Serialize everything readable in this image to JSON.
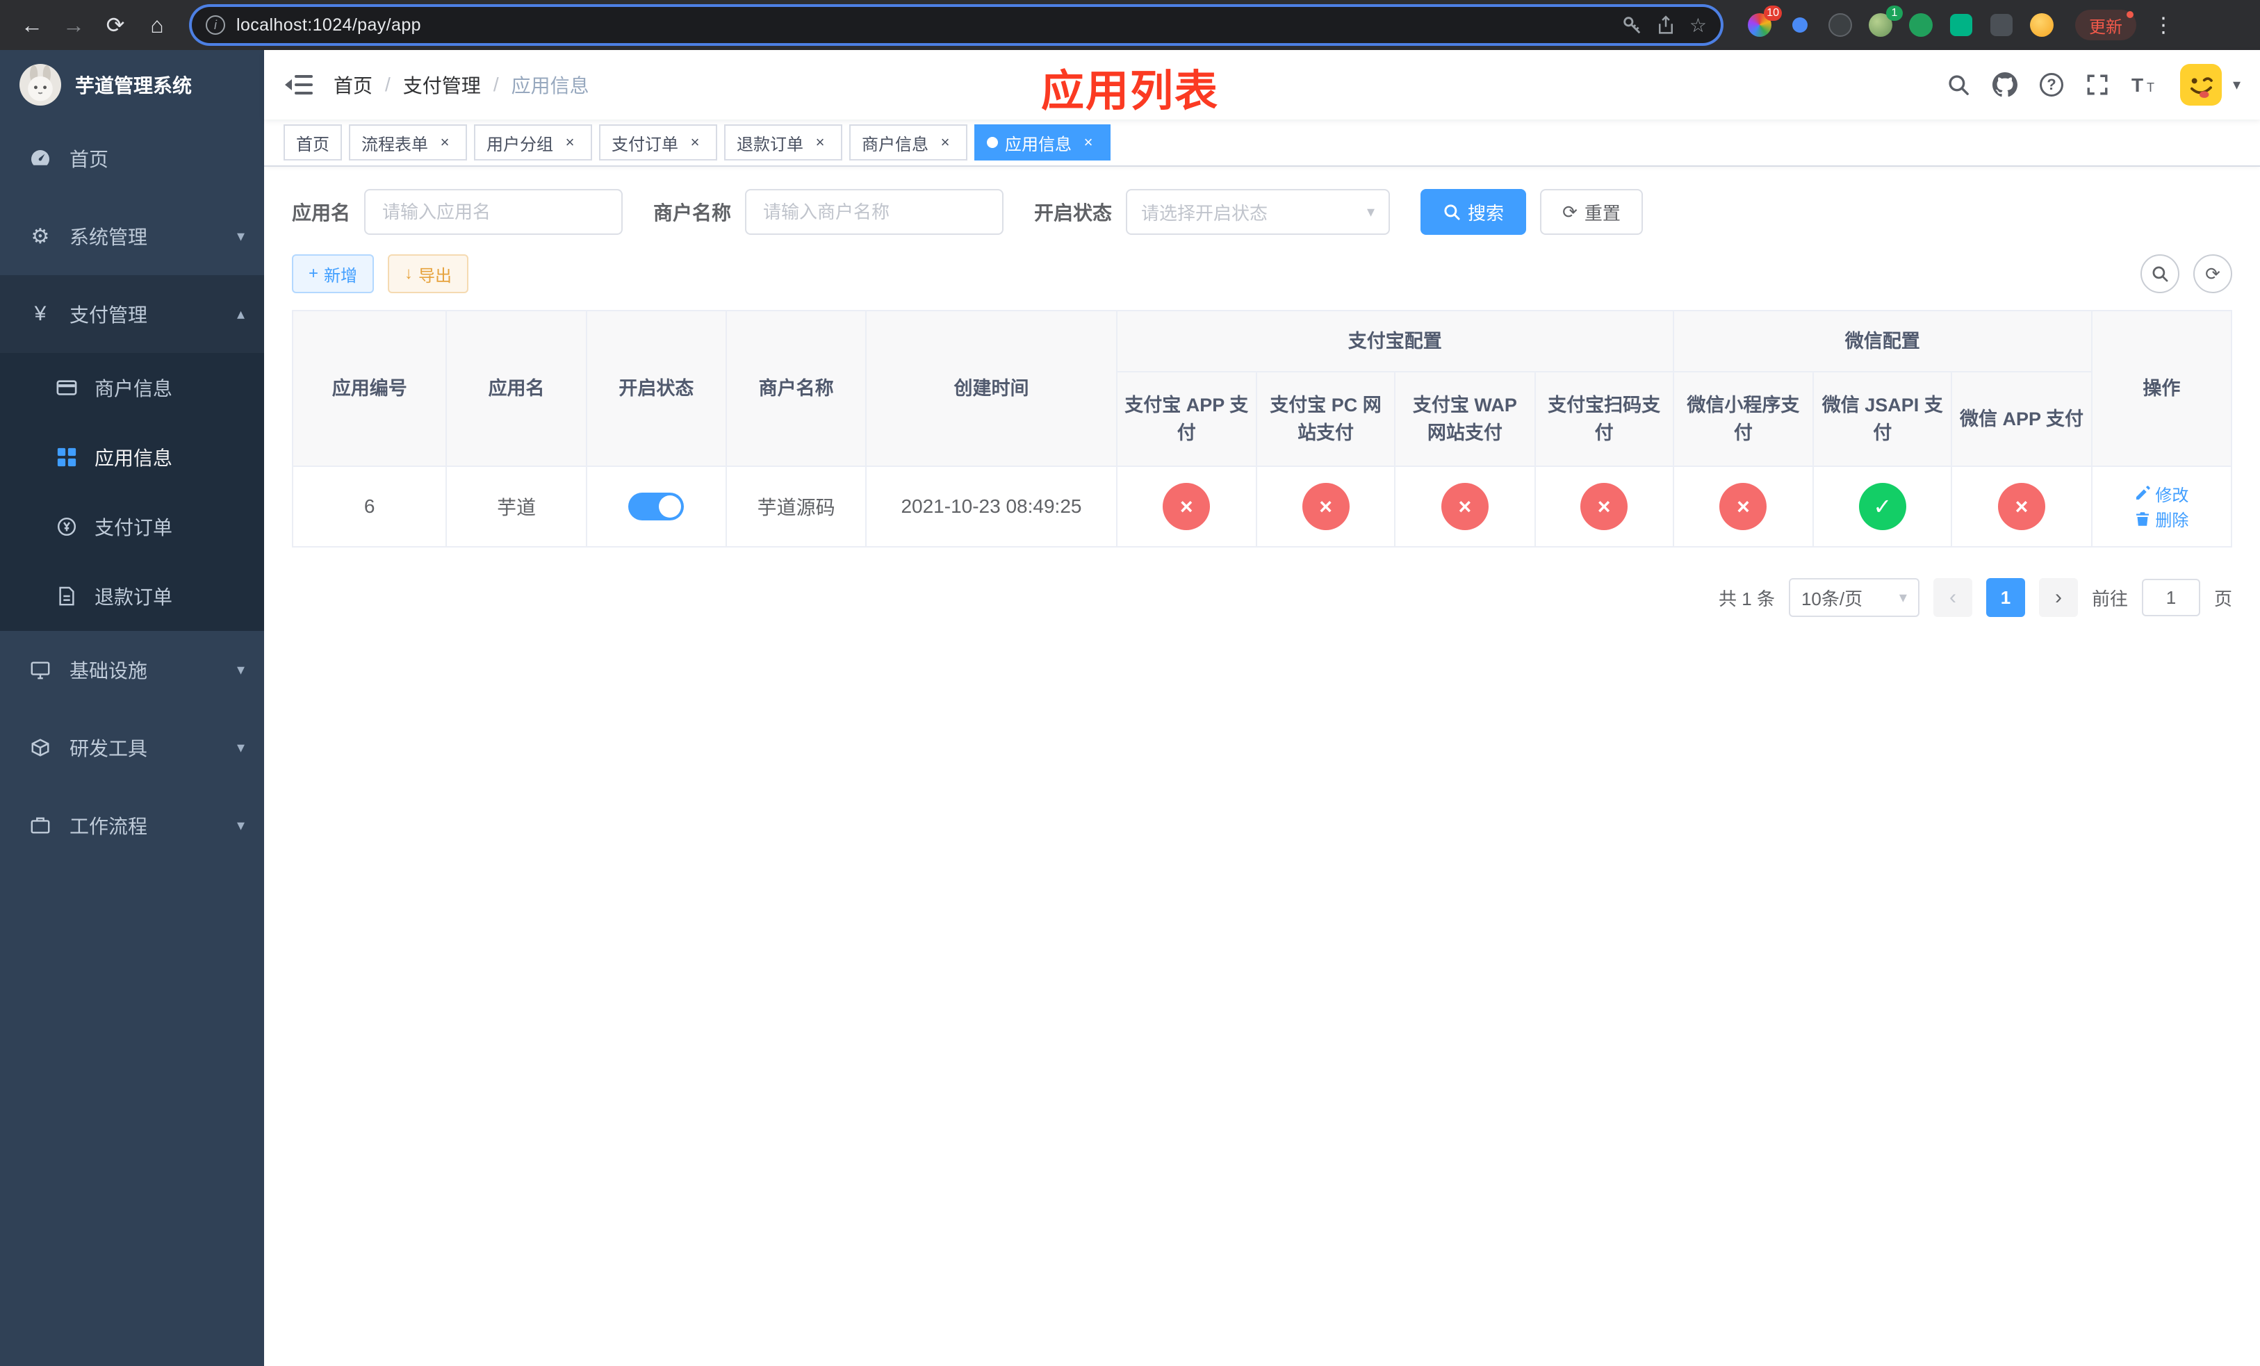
{
  "browser": {
    "url": "localhost:1024/pay/app",
    "update_label": "更新",
    "ext_badges": {
      "grid": "10",
      "avatar": "1"
    }
  },
  "icons": {
    "back": "←",
    "forward": "→",
    "reload": "⟳",
    "home": "⌂",
    "more": "⋮",
    "star": "☆",
    "info": "i",
    "gear": "⚙",
    "yen": "¥",
    "chevron_down": "▾",
    "chevron_up": "▴",
    "caret_down": "▾",
    "prev": "‹",
    "next": "›",
    "check": "✓",
    "cross": "×",
    "plus": "+",
    "download": "↓",
    "refresh": "⟳",
    "question": "?"
  },
  "sidebar": {
    "title": "芋道管理系统",
    "home": "首页",
    "system": "系统管理",
    "payment": "支付管理",
    "sub": {
      "merchant": "商户信息",
      "app": "应用信息",
      "order": "支付订单",
      "refund": "退款订单"
    },
    "infra": "基础设施",
    "devtools": "研发工具",
    "workflow": "工作流程"
  },
  "header": {
    "breadcrumb": [
      "首页",
      "支付管理",
      "应用信息"
    ],
    "separator": "/",
    "overlay_title": "应用列表"
  },
  "tabs": [
    {
      "label": "首页"
    },
    {
      "label": "流程表单"
    },
    {
      "label": "用户分组"
    },
    {
      "label": "支付订单"
    },
    {
      "label": "退款订单"
    },
    {
      "label": "商户信息"
    },
    {
      "label": "应用信息"
    }
  ],
  "filters": {
    "app_name_label": "应用名",
    "app_name_placeholder": "请输入应用名",
    "merchant_label": "商户名称",
    "merchant_placeholder": "请输入商户名称",
    "status_label": "开启状态",
    "status_placeholder": "请选择开启状态",
    "search_label": "搜索",
    "reset_label": "重置"
  },
  "toolbar": {
    "add_label": "新增",
    "export_label": "导出"
  },
  "table": {
    "columns": {
      "id": "应用编号",
      "name": "应用名",
      "status": "开启状态",
      "merchant": "商户名称",
      "created": "创建时间",
      "actions": "操作",
      "alipay_group": "支付宝配置",
      "wechat_group": "微信配置",
      "alipay_app": "支付宝 APP 支付",
      "alipay_pc": "支付宝 PC 网站支付",
      "alipay_wap": "支付宝 WAP 网站支付",
      "alipay_qr": "支付宝扫码支付",
      "wx_mini": "微信小程序支付",
      "wx_jsapi": "微信 JSAPI 支付",
      "wx_app": "微信 APP 支付"
    },
    "rows": [
      {
        "id": "6",
        "name": "芋道",
        "status_on": true,
        "merchant": "芋道源码",
        "created": "2021-10-23 08:49:25",
        "configs": [
          false,
          false,
          false,
          false,
          false,
          true,
          false
        ],
        "edit_label": "修改",
        "delete_label": "删除"
      }
    ]
  },
  "pagination": {
    "total": "共 1 条",
    "page_size": "10条/页",
    "page": "1",
    "goto": "前往",
    "goto_value": "1",
    "unit": "页"
  },
  "colors": {
    "accent": "#409eff",
    "danger": "#f56c6c",
    "success": "#13ce66",
    "sidebar_bg": "#304156",
    "submenu_bg": "#1f2d3d"
  }
}
